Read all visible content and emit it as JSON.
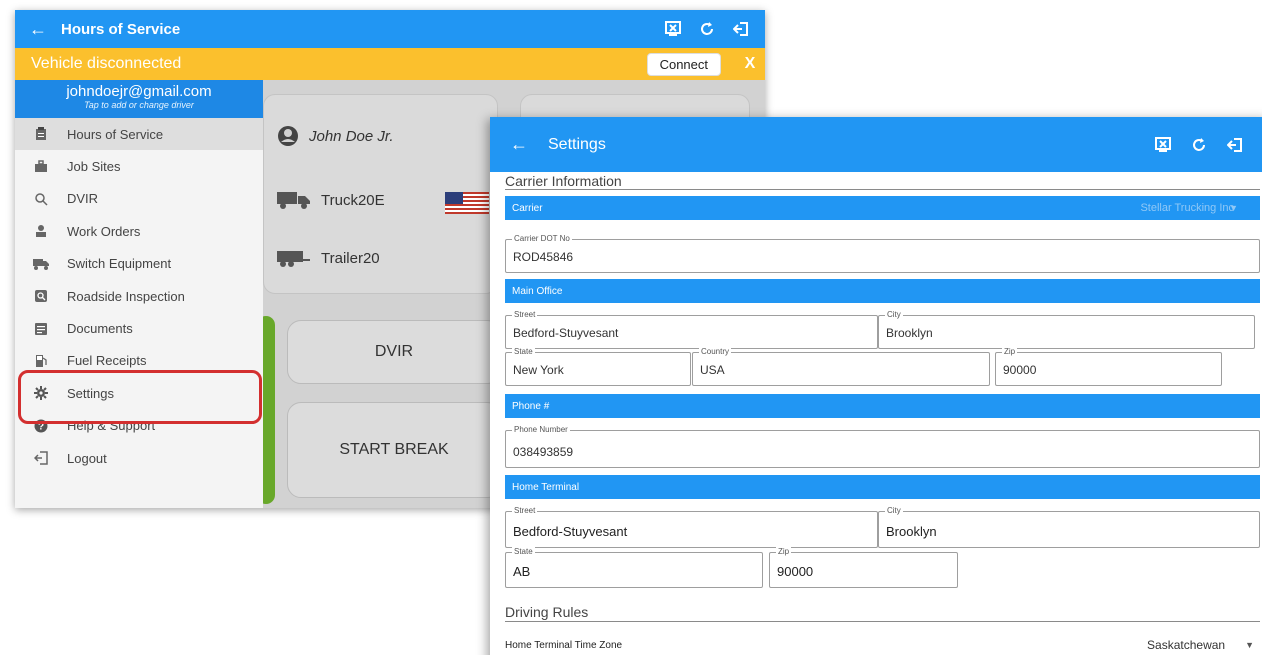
{
  "background_app": {
    "title": "Hours of Service",
    "banner": {
      "message": "Vehicle disconnected",
      "connect_label": "Connect",
      "close_label": "X"
    },
    "drawer": {
      "email": "johndoejr@gmail.com",
      "subtitle": "Tap to add or change driver",
      "items": [
        {
          "label": "Hours of Service",
          "icon": "clipboard-icon"
        },
        {
          "label": "Job Sites",
          "icon": "briefcase-icon"
        },
        {
          "label": "DVIR",
          "icon": "search-icon"
        },
        {
          "label": "Work Orders",
          "icon": "worker-icon"
        },
        {
          "label": "Switch Equipment",
          "icon": "truck-icon"
        },
        {
          "label": "Roadside Inspection",
          "icon": "inspection-icon"
        },
        {
          "label": "Documents",
          "icon": "document-icon"
        },
        {
          "label": "Fuel Receipts",
          "icon": "fuel-icon"
        },
        {
          "label": "Settings",
          "icon": "gear-icon"
        },
        {
          "label": "Help & Support",
          "icon": "help-icon"
        },
        {
          "label": "Logout",
          "icon": "logout-icon"
        }
      ]
    },
    "dashboard": {
      "driver_name": "John Doe Jr.",
      "truck": "Truck20E",
      "trailer": "Trailer20",
      "dvir_button": "DVIR",
      "start_break_button": "START BREAK"
    }
  },
  "settings": {
    "title": "Settings",
    "carrier_section_title": "Carrier Information",
    "carrier": {
      "label": "Carrier",
      "value": "Stellar Trucking Inc"
    },
    "carrier_dot": {
      "label": "Carrier DOT No",
      "value": "ROD45846"
    },
    "main_office": {
      "header": "Main Office",
      "street": {
        "label": "Street",
        "value": "Bedford-Stuyvesant"
      },
      "city": {
        "label": "City",
        "value": "Brooklyn"
      },
      "state": {
        "label": "State",
        "value": "New York"
      },
      "country": {
        "label": "Country",
        "value": "USA"
      },
      "zip": {
        "label": "Zip",
        "value": "90000"
      }
    },
    "phone": {
      "header": "Phone #",
      "label": "Phone Number",
      "value": "038493859"
    },
    "home_terminal": {
      "header": "Home Terminal",
      "street": {
        "label": "Street",
        "value": "Bedford-Stuyvesant"
      },
      "city": {
        "label": "City",
        "value": "Brooklyn"
      },
      "state": {
        "label": "State",
        "value": "AB"
      },
      "zip": {
        "label": "Zip",
        "value": "90000"
      }
    },
    "driving_rules_title": "Driving Rules",
    "time_zone": {
      "label": "Home Terminal Time Zone",
      "value": "Saskatchewan"
    }
  },
  "colors": {
    "primary_blue": "#2196f3",
    "warning_yellow": "#fbc02d",
    "highlight_red": "#d32f2f",
    "status_green": "#68a82a"
  }
}
